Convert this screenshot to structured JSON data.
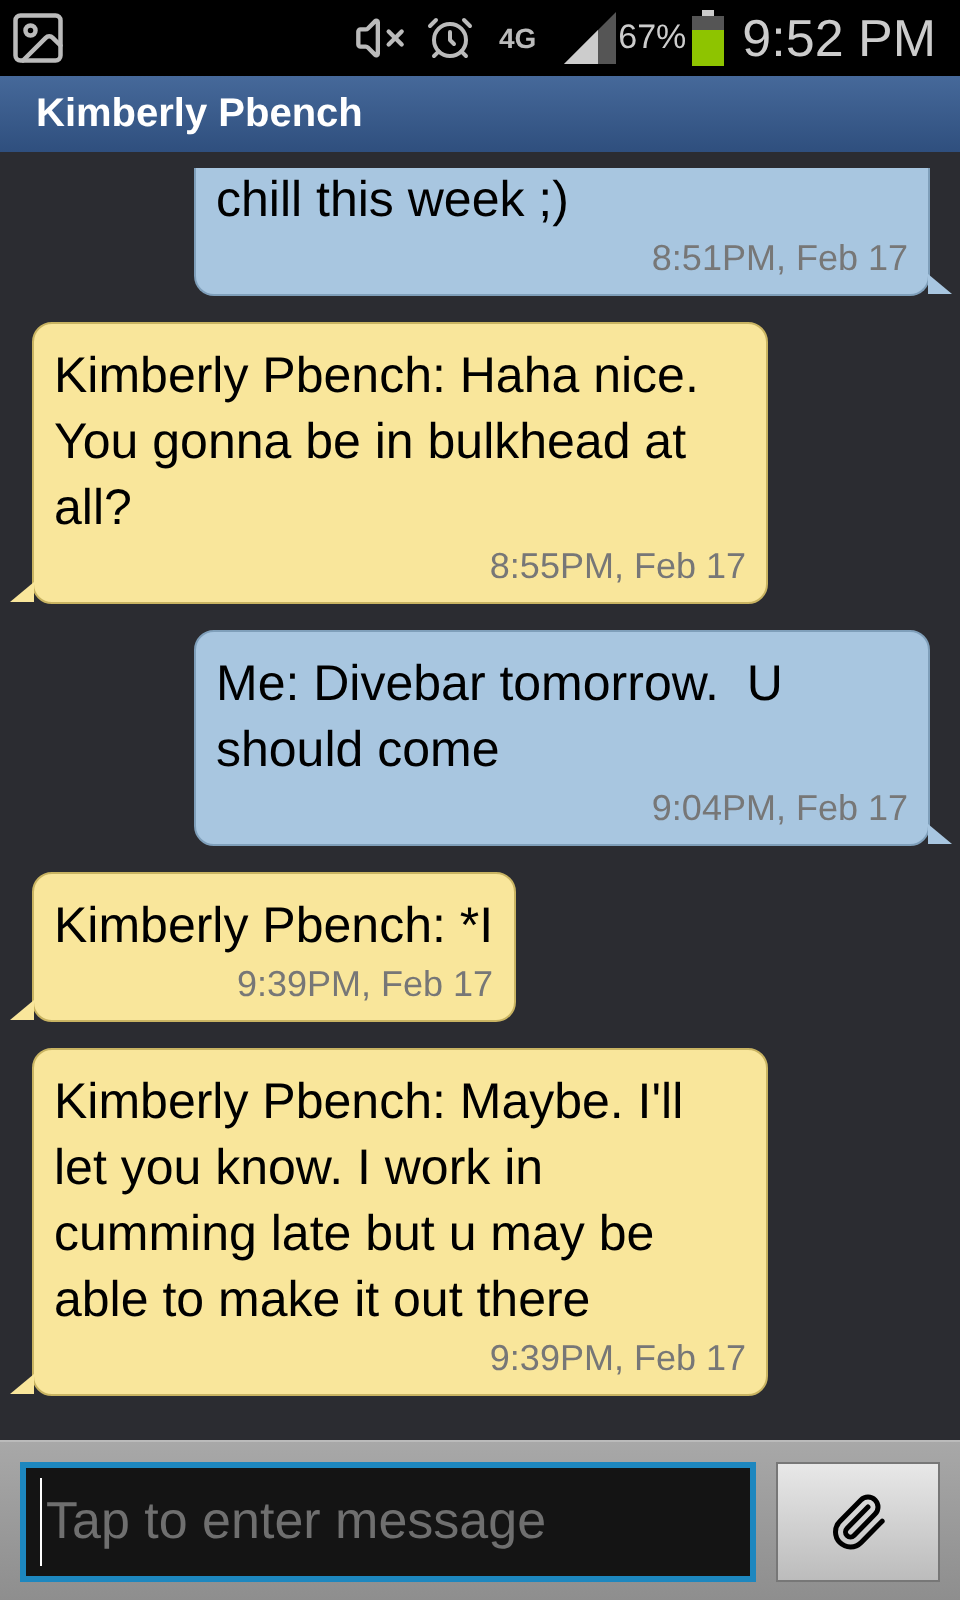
{
  "status_bar": {
    "network": "4G",
    "battery": "67%",
    "time": "9:52 PM"
  },
  "header": {
    "title": "Kimberly Pbench"
  },
  "messages": [
    {
      "kind": "sent",
      "text": "chill this week ;)",
      "time": "8:51PM, Feb 17",
      "clipped": true
    },
    {
      "kind": "received",
      "text": "Kimberly Pbench: Haha nice. You gonna be in bulkhead at all?",
      "time": "8:55PM, Feb 17",
      "clipped": false
    },
    {
      "kind": "sent",
      "text": "Me: Divebar tomorrow.  U should come",
      "time": "9:04PM, Feb 17",
      "clipped": false
    },
    {
      "kind": "received",
      "text": "Kimberly Pbench: *I",
      "time": "9:39PM, Feb 17",
      "clipped": false
    },
    {
      "kind": "received",
      "text": "Kimberly Pbench: Maybe. I'll let you know. I work in cumming late but u may be able to make it out there",
      "time": "9:39PM, Feb 17",
      "clipped": false
    }
  ],
  "composer": {
    "placeholder": "Tap to enter message"
  }
}
